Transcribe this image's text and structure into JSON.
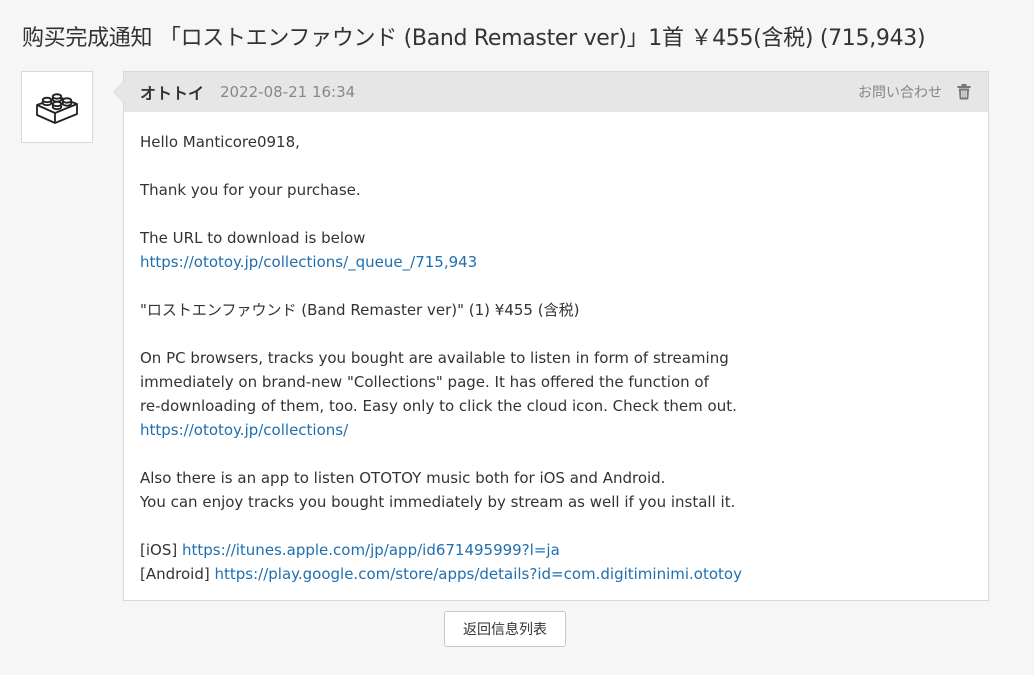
{
  "page": {
    "title": "购买完成通知 「ロストエンファウンド (Band Remaster ver)」1首 ￥455(含税) (715,943)"
  },
  "message": {
    "avatar_icon": "lego-brick-icon",
    "sender": "オトトイ",
    "timestamp": "2022-08-21 16:34",
    "contact_label": "お問い合わせ",
    "delete_icon": "trash-icon",
    "greeting": "Hello Manticore0918,",
    "thanks": "Thank you for your purchase.",
    "download_intro": "The URL to download is below",
    "download_url": "https://ototoy.jp/collections/_queue_/715,943",
    "item_line": "\"ロストエンファウンド (Band Remaster ver)\" (1) ¥455 (含税)",
    "collections_lines": [
      "On PC browsers, tracks you bought are available to listen in form of streaming",
      "immediately on brand-new \"Collections\" page. It has offered the function of",
      "re-downloading of them, too. Easy only to click the cloud icon. Check them out."
    ],
    "collections_url": "https://ototoy.jp/collections/",
    "app_lines": [
      "Also there is an app to listen OTOTOY music both for iOS and Android.",
      "You can enjoy tracks you bought immediately by stream as well if you install it."
    ],
    "ios_label": "[iOS]",
    "ios_url": "https://itunes.apple.com/jp/app/id671495999?l=ja",
    "android_label": "[Android]",
    "android_url": "https://play.google.com/store/apps/details?id=com.digitiminimi.ototoy"
  },
  "footer": {
    "back_label": "返回信息列表"
  },
  "colors": {
    "link": "#1f6fb0",
    "header_bg": "#e6e6e6",
    "page_bg": "#f6f6f6"
  }
}
